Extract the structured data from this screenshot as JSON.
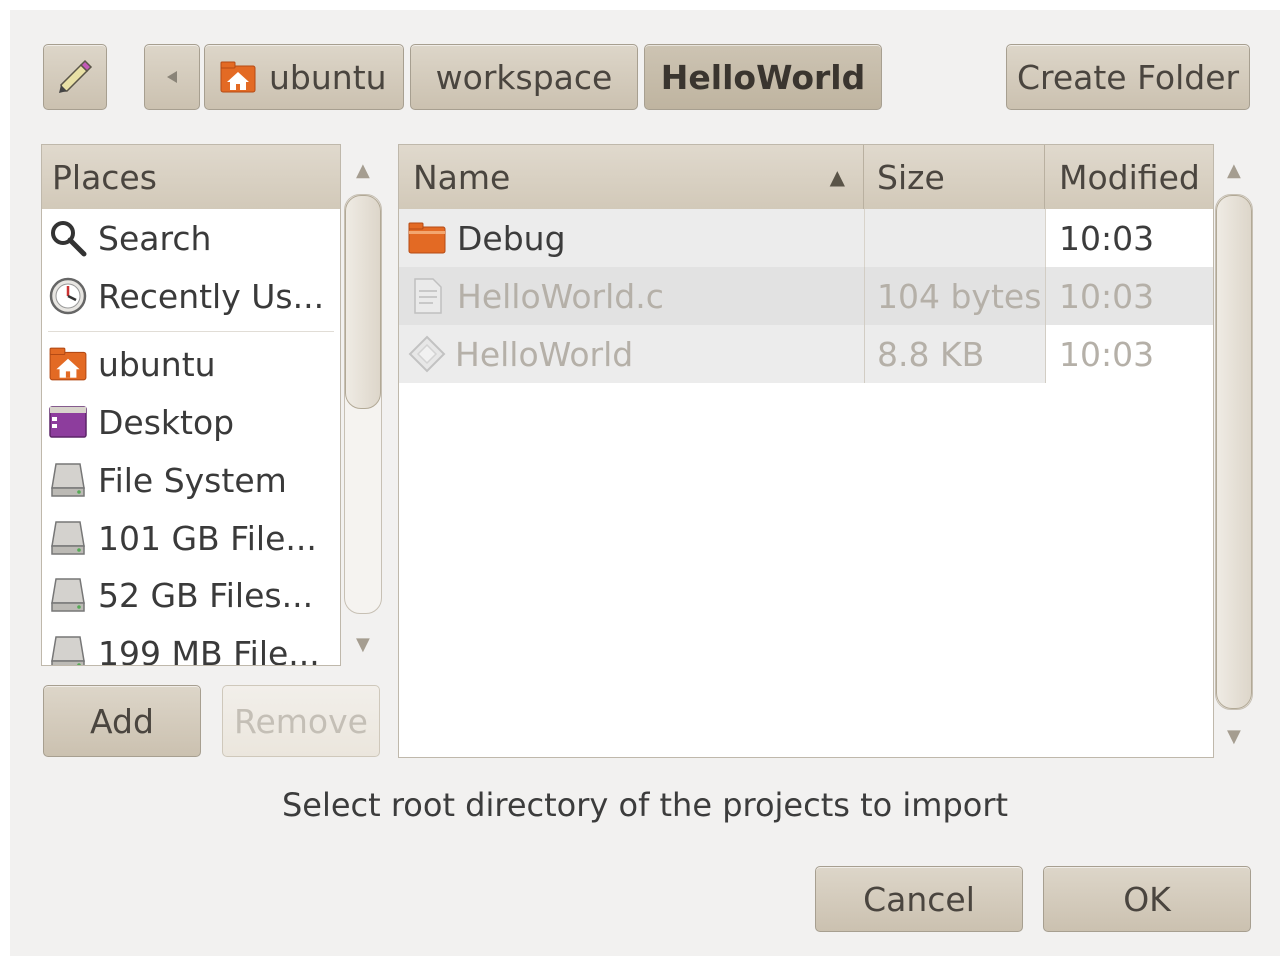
{
  "toolbar": {
    "edit_location_icon": "pencil-icon",
    "back_icon": "triangle-left-icon",
    "path": [
      {
        "label": "ubuntu",
        "icon": "home-folder-icon"
      },
      {
        "label": "workspace"
      },
      {
        "label": "HelloWorld",
        "active": true
      }
    ],
    "create_folder_label": "Create Folder"
  },
  "places": {
    "header": "Places",
    "items": [
      {
        "label": "Search",
        "icon": "search-icon"
      },
      {
        "label": "Recently Us...",
        "icon": "recent-icon"
      },
      {
        "label": "ubuntu",
        "icon": "home-folder-icon"
      },
      {
        "label": "Desktop",
        "icon": "desktop-icon"
      },
      {
        "label": "File System",
        "icon": "drive-icon"
      },
      {
        "label": "101 GB File...",
        "icon": "drive-icon"
      },
      {
        "label": "52 GB Files...",
        "icon": "drive-icon"
      },
      {
        "label": "199 MB File...",
        "icon": "drive-icon"
      }
    ],
    "add_label": "Add",
    "remove_label": "Remove"
  },
  "files": {
    "columns": {
      "name": "Name",
      "size": "Size",
      "modified": "Modified"
    },
    "sort_indicator": "▲",
    "rows": [
      {
        "name": "Debug",
        "size": "",
        "modified": "10:03",
        "icon": "folder-icon",
        "dimmed": false
      },
      {
        "name": "HelloWorld.c",
        "size": "104 bytes",
        "modified": "10:03",
        "icon": "text-file-icon",
        "dimmed": true
      },
      {
        "name": "HelloWorld",
        "size": "8.8 KB",
        "modified": "10:03",
        "icon": "executable-icon",
        "dimmed": true
      }
    ]
  },
  "message": "Select root directory of the projects to import",
  "buttons": {
    "cancel": "Cancel",
    "ok": "OK"
  },
  "colors": {
    "button_bg": "#d2c9b9",
    "folder_orange": "#e36a24",
    "desktop_purple": "#7b3a8a"
  }
}
